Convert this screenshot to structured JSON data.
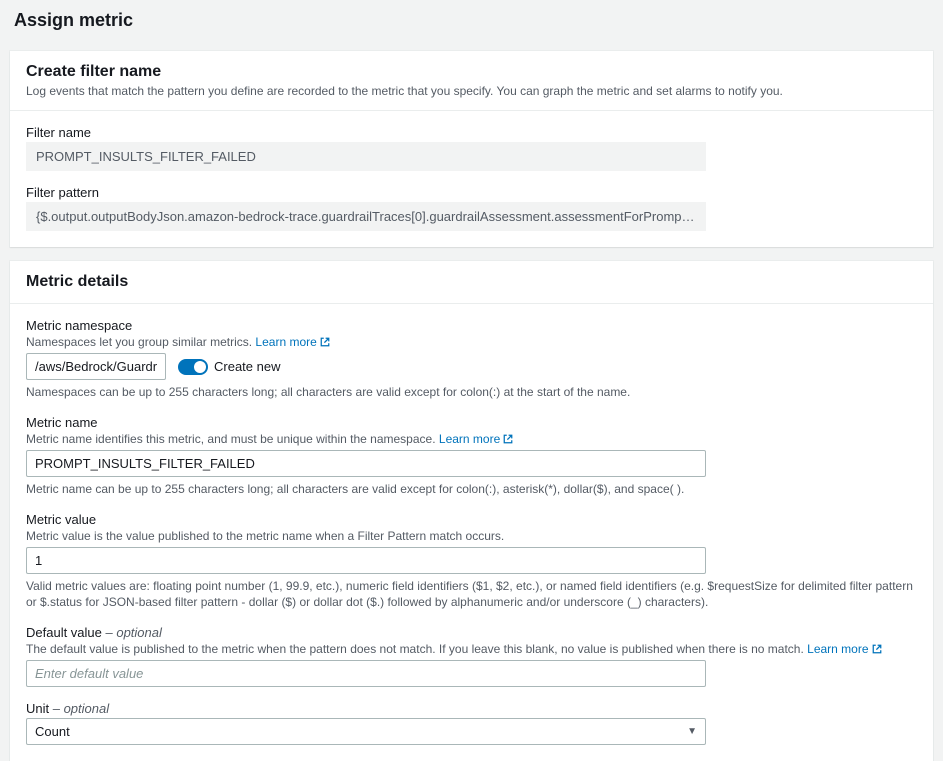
{
  "page": {
    "title": "Assign metric"
  },
  "filter_panel": {
    "title": "Create filter name",
    "subtitle": "Log events that match the pattern you define are recorded to the metric that you specify. You can graph the metric and set alarms to notify you.",
    "name_label": "Filter name",
    "name_value": "PROMPT_INSULTS_FILTER_FAILED",
    "pattern_label": "Filter pattern",
    "pattern_value": "{$.output.outputBodyJson.amazon-bedrock-trace.guardrailTraces[0].guardrailAssessment.assessmentForPrompt.contentPolicyAssessment.textTo"
  },
  "metric_panel": {
    "title": "Metric details",
    "namespace": {
      "label": "Metric namespace",
      "desc": "Namespaces let you group similar metrics.",
      "learn_more": "Learn more",
      "value": "/aws/Bedrock/Guardrails",
      "toggle_label": "Create new",
      "constraint": "Namespaces can be up to 255 characters long; all characters are valid except for colon(:) at the start of the name."
    },
    "name": {
      "label": "Metric name",
      "desc": "Metric name identifies this metric, and must be unique within the namespace.",
      "learn_more": "Learn more",
      "value": "PROMPT_INSULTS_FILTER_FAILED",
      "constraint": "Metric name can be up to 255 characters long; all characters are valid except for colon(:), asterisk(*), dollar($), and space( )."
    },
    "value": {
      "label": "Metric value",
      "desc": "Metric value is the value published to the metric name when a Filter Pattern match occurs.",
      "value": "1",
      "constraint": "Valid metric values are: floating point number (1, 99.9, etc.), numeric field identifiers ($1, $2, etc.), or named field identifiers (e.g. $requestSize for delimited filter pattern or $.status for JSON-based filter pattern - dollar ($) or dollar dot ($.) followed by alphanumeric and/or underscore (_) characters)."
    },
    "default": {
      "label": "Default value",
      "optional": " – optional",
      "desc": "The default value is published to the metric when the pattern does not match. If you leave this blank, no value is published when there is no match.",
      "learn_more": "Learn more",
      "placeholder": "Enter default value"
    },
    "unit": {
      "label": "Unit",
      "optional": " – optional",
      "value": "Count"
    }
  }
}
